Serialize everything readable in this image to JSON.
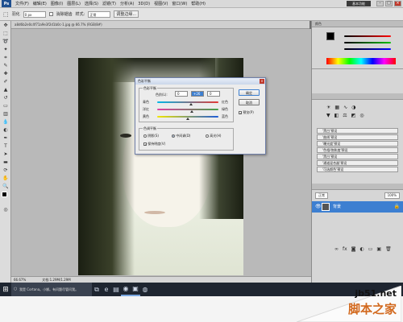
{
  "menubar": {
    "app_logo": "Ps",
    "items": [
      "文件(F)",
      "编辑(E)",
      "图像(I)",
      "图层(L)",
      "选择(S)",
      "滤镜(T)",
      "分析(A)",
      "3D(D)",
      "视图(V)",
      "窗口(W)",
      "帮助(H)"
    ],
    "workspace": "基本功能"
  },
  "options": {
    "feather_label": "羽化",
    "feather_value": "0 px",
    "style_label": "样式:",
    "style_value": "正常",
    "antialias_label": "消除锯齿",
    "refine_label": "调整边缘..."
  },
  "document": {
    "tab_title": "a8d6b2e0c4f71a9e3f2d1b0c-1.jpg @ 66.7% (RGB/8#)",
    "zoom": "66.67%",
    "doc_size": "文档:1.29M/1.29M"
  },
  "dialog": {
    "title": "色彩平衡",
    "group_balance": "色彩平衡",
    "levels_label": "色阶(L):",
    "levels": [
      "0",
      "+26",
      "0"
    ],
    "rows": [
      {
        "left": "青色",
        "right": "红色",
        "position": 0.55
      },
      {
        "left": "洋红",
        "right": "绿色",
        "position": 0.57
      },
      {
        "left": "黄色",
        "right": "蓝色",
        "position": 0.5
      }
    ],
    "group_tone": "色调平衡",
    "tone_options": [
      "阴影(S)",
      "中间调(D)",
      "高光(H)"
    ],
    "tone_selected": 1,
    "preserve_luminosity": "保持明度(V)",
    "buttons": {
      "ok": "确定",
      "cancel": "取消"
    },
    "preview": "预览(P)"
  },
  "panels": {
    "color_tab": "颜色",
    "adjust_items": [
      "'黑白'预设",
      "'曲线'预设",
      "'曝光度'预设",
      "'色相/饱和度'预设",
      "'黑白'预设",
      "'通道混合器'预设",
      "'可选颜色'预设"
    ],
    "layers": {
      "blend": "正常",
      "opacity": "100%",
      "layer_name": "背景"
    }
  },
  "taskbar": {
    "search_placeholder": "我是 Cortana。小娜。有问题尽管问我。"
  },
  "watermark": {
    "site": "jb51.net",
    "name": "脚本之家"
  },
  "colors": {
    "accent": "#3d7fd1",
    "taskbar": "#1e2530"
  }
}
